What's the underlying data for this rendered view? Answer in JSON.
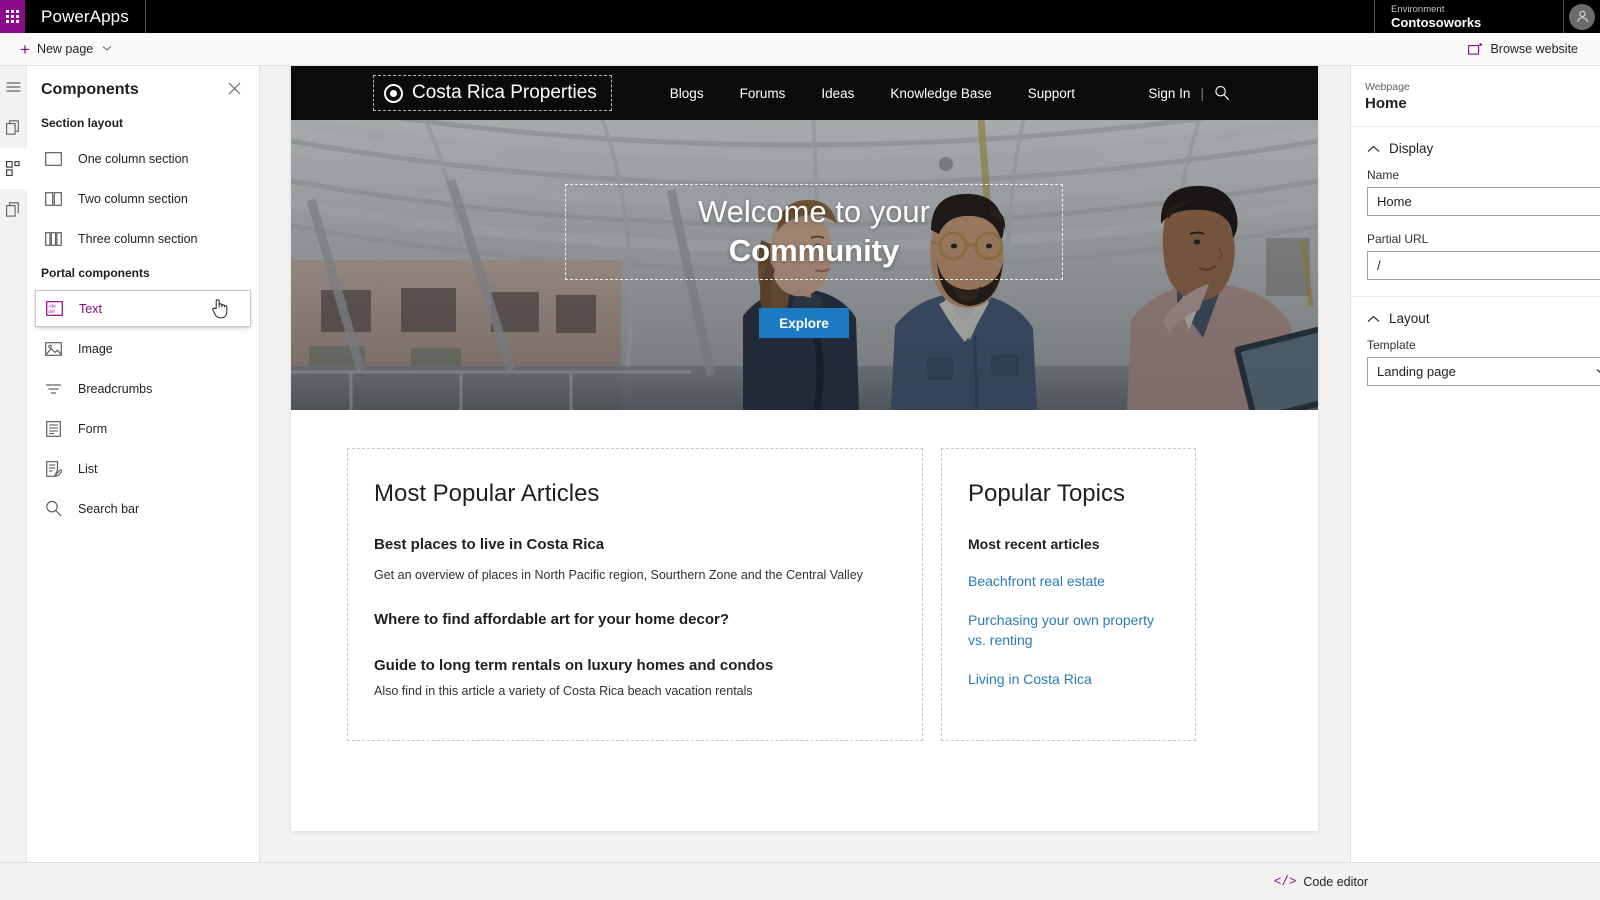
{
  "app_bar": {
    "waffle_icon": "waffle-grid-icon",
    "brand": "PowerApps",
    "environment_label": "Environment",
    "environment_value": "Contosoworks",
    "avatar_icon": "user-avatar-icon"
  },
  "command_bar": {
    "new_page_label": "New page",
    "new_page_icon": "plus-icon",
    "new_page_chevron": "chevron-down-icon",
    "browse_website_label": "Browse website",
    "browse_website_icon": "external-window-icon"
  },
  "rail": {
    "items": [
      {
        "name": "hamburger-menu",
        "icon": "hamburger-icon",
        "active": false
      },
      {
        "name": "pages",
        "icon": "pages-icon",
        "active": false
      },
      {
        "name": "components",
        "icon": "components-grid-icon",
        "active": true
      },
      {
        "name": "templates",
        "icon": "page-copy-icon",
        "active": false
      }
    ]
  },
  "components_panel": {
    "title": "Components",
    "close_icon": "close-icon",
    "sections": [
      {
        "heading": "Section layout",
        "items": [
          {
            "label": "One column section",
            "icon": "one-column-icon",
            "hovered": false
          },
          {
            "label": "Two column section",
            "icon": "two-column-icon",
            "hovered": false
          },
          {
            "label": "Three column section",
            "icon": "three-column-icon",
            "hovered": false
          }
        ]
      },
      {
        "heading": "Portal components",
        "items": [
          {
            "label": "Text",
            "icon": "text-abc-icon",
            "hovered": true
          },
          {
            "label": "Image",
            "icon": "image-icon",
            "hovered": false
          },
          {
            "label": "Breadcrumbs",
            "icon": "breadcrumbs-icon",
            "hovered": false
          },
          {
            "label": "Form",
            "icon": "form-icon",
            "hovered": false
          },
          {
            "label": "List",
            "icon": "list-icon",
            "hovered": false
          },
          {
            "label": "Search bar",
            "icon": "search-icon",
            "hovered": false
          }
        ]
      }
    ],
    "cursor_icon": "pointing-hand-cursor"
  },
  "canvas": {
    "site_header": {
      "logo_text": "Costa Rica Properties",
      "logo_icon": "ring-logo-icon",
      "nav": [
        {
          "label": "Blogs"
        },
        {
          "label": "Forums"
        },
        {
          "label": "Ideas"
        },
        {
          "label": "Knowledge Base"
        },
        {
          "label": "Support"
        }
      ],
      "sign_in": "Sign In",
      "separator": "|",
      "search_icon": "search-icon"
    },
    "hero": {
      "line1": "Welcome to your",
      "line2": "Community",
      "button_label": "Explore",
      "button_color": "#1b7ac2",
      "photo_alt": "three-people-talking-in-glass-corridor"
    },
    "articles_card": {
      "title": "Most Popular Articles",
      "items": [
        {
          "title": "Best places to live in Costa Rica",
          "desc": "Get an overview of places in North Pacific region, Sourthern Zone and the Central Valley"
        },
        {
          "title": "Where to find affordable art for your home decor?",
          "desc": ""
        },
        {
          "title": "Guide to long term rentals on luxury homes and condos",
          "desc": "Also find in this article  a variety of Costa Rica beach vacation rentals"
        }
      ]
    },
    "topics_card": {
      "title": "Popular Topics",
      "subtitle": "Most recent articles",
      "link_color": "#2a7ab9",
      "links": [
        {
          "label": "Beachfront real estate"
        },
        {
          "label": "Purchasing your own property vs. renting"
        },
        {
          "label": "Living in Costa Rica"
        }
      ]
    }
  },
  "properties_panel": {
    "kind": "Webpage",
    "name": "Home",
    "display_group": {
      "title": "Display",
      "chevron": "chevron-up-icon",
      "name_label": "Name",
      "name_value": "Home",
      "partial_url_label": "Partial URL",
      "partial_url_value": "/"
    },
    "layout_group": {
      "title": "Layout",
      "chevron": "chevron-up-icon",
      "template_label": "Template",
      "template_value": "Landing page",
      "template_chevron": "chevron-down-icon"
    }
  },
  "bottom_bar": {
    "code_editor_label": "Code editor",
    "code_editor_icon": "code-brackets-icon"
  }
}
